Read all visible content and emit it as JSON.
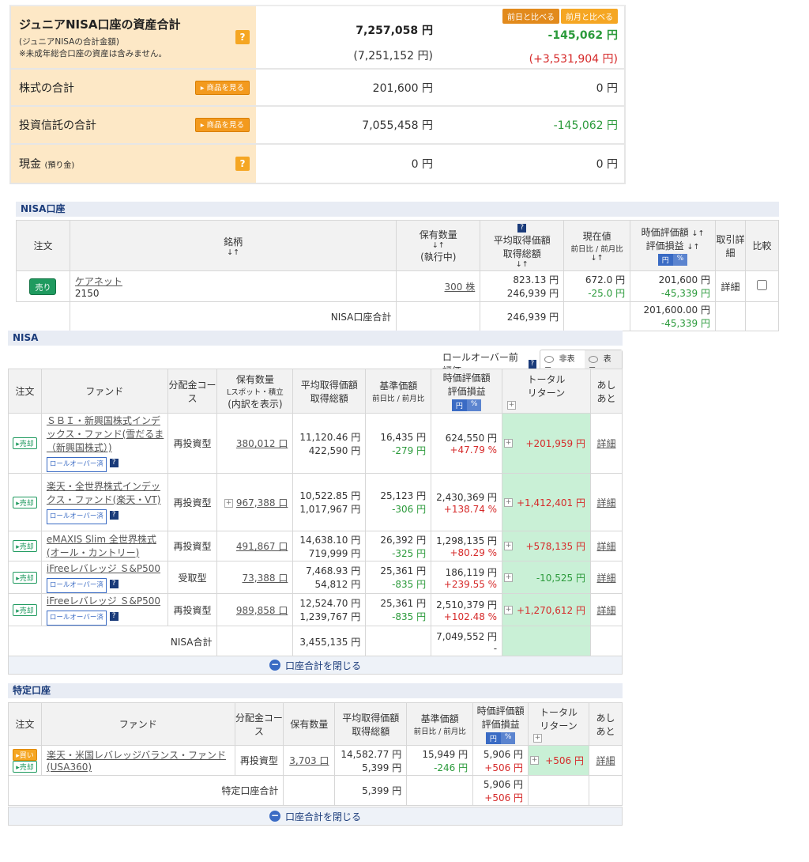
{
  "summary": {
    "compare_buttons": [
      "前日と比べる",
      "前月と比べる"
    ],
    "total": {
      "label": "ジュニアNISA口座の資産合計",
      "note1": "(ジュニアNISAの合計金額)",
      "note2": "※未成年総合口座の資産は含みません。",
      "value": "7,257,058 円",
      "value_sub": "(7,251,152 円)",
      "diff": "-145,062 円",
      "diff_sub": "(+3,531,904 円)"
    },
    "stocks": {
      "label": "株式の合計",
      "button": "商品を見る",
      "value": "201,600 円",
      "diff": "0 円"
    },
    "funds": {
      "label": "投資信託の合計",
      "button": "商品を見る",
      "value": "7,055,458 円",
      "diff": "-145,062 円"
    },
    "cash": {
      "label": "現金",
      "label_sub": "(預り金)",
      "value": "0 円",
      "diff": "0 円"
    }
  },
  "nisa_account": {
    "title": "NISA口座",
    "headers": {
      "order": "注文",
      "name": "銘柄",
      "qty": "保有数量",
      "qty_sub": "(執行中)",
      "avg": "平均取得価額",
      "avg_sub": "取得総額",
      "price": "現在値",
      "price_sub": "前日比 / 前月比",
      "val": "時価評価額",
      "val_sub": "評価損益",
      "trade": "取引詳細",
      "compare": "比較"
    },
    "row": {
      "button": "売り",
      "name": "ケアネット",
      "code": "2150",
      "qty": "300 株",
      "avg": "823.13 円",
      "total": "246,939 円",
      "price": "672.0 円",
      "change": "-25.0 円",
      "val": "201,600 円",
      "pl": "-45,339 円",
      "detail": "詳細"
    },
    "total": {
      "label": "NISA口座合計",
      "cost": "246,939 円",
      "val": "201,600.00 円",
      "pl": "-45,339 円"
    }
  },
  "nisa_funds": {
    "title": "NISA",
    "rollover_label": "ロールオーバー前評価",
    "toggle": [
      "非表示",
      "表示"
    ],
    "headers": {
      "order": "注文",
      "fund": "ファンド",
      "course": "分配金コース",
      "qty": "保有数量",
      "qty_sub": "Lスポット・積立",
      "qty_sub2": "(内訳を表示)",
      "avg": "平均取得価額",
      "avg_sub": "取得総額",
      "base": "基準価額",
      "base_sub": "前日比 / 前月比",
      "val": "時価評価額",
      "val_sub": "評価損益",
      "total_return": "トータルリターン",
      "ashi": "あしあと"
    },
    "rows": [
      {
        "name": "ＳＢＩ・新興国株式インデックス・ファンド(雪だるま（新興国株式）)",
        "course": "再投資型",
        "qty": "380,012 口",
        "avg": "11,120.46 円",
        "cost": "422,590 円",
        "base": "16,435 円",
        "change": "-279 円",
        "val": "624,550 円",
        "pl": "+47.79 %",
        "ret": "+201,959 円",
        "rollover": true
      },
      {
        "name": "楽天・全世界株式インデックス・ファンド(楽天・VT)",
        "course": "再投資型",
        "qty": "967,388 口",
        "avg": "10,522.85 円",
        "cost": "1,017,967 円",
        "base": "25,123 円",
        "change": "-306 円",
        "val": "2,430,369 円",
        "pl": "+138.74 %",
        "ret": "+1,412,401 円",
        "rollover": true
      },
      {
        "name": "eMAXIS Slim 全世界株式(オール・カントリー)",
        "course": "再投資型",
        "qty": "491,867 口",
        "avg": "14,638.10 円",
        "cost": "719,999 円",
        "base": "26,392 円",
        "change": "-325 円",
        "val": "1,298,135 円",
        "pl": "+80.29 %",
        "ret": "+578,135 円",
        "rollover": false
      },
      {
        "name": "iFreeレバレッジ Ｓ&P500",
        "course": "受取型",
        "qty": "73,388 口",
        "avg": "7,468.93 円",
        "cost": "54,812 円",
        "base": "25,361 円",
        "change": "-835 円",
        "val": "186,119 円",
        "pl": "+239.55 %",
        "ret": "-10,525 円",
        "rollover": true
      },
      {
        "name": "iFreeレバレッジ Ｓ&P500",
        "course": "再投資型",
        "qty": "989,858 口",
        "avg": "12,524.70 円",
        "cost": "1,239,767 円",
        "base": "25,361 円",
        "change": "-835 円",
        "val": "2,510,379 円",
        "pl": "+102.48 %",
        "ret": "+1,270,612 円",
        "rollover": true
      }
    ],
    "sell": "売却",
    "rollover_badge": "ロールオーバー済",
    "detail": "詳細",
    "total": {
      "label": "NISA合計",
      "cost": "3,455,135 円",
      "val": "7,049,552 円",
      "pl": "-"
    },
    "close": "口座合計を閉じる"
  },
  "tokutei": {
    "title": "特定口座",
    "headers": {
      "order": "注文",
      "fund": "ファンド",
      "course": "分配金コース",
      "qty": "保有数量",
      "avg": "平均取得価額",
      "avg_sub": "取得総額",
      "base": "基準価額",
      "base_sub": "前日比 / 前月比",
      "val": "時価評価額",
      "val_sub": "評価損益",
      "total_return": "トータルリターン",
      "ashi": "あしあと"
    },
    "row": {
      "buy": "買い",
      "sell": "売却",
      "name": "楽天・米国レバレッジバランス・ファンド(USA360)",
      "course": "再投資型",
      "qty": "3,703 口",
      "avg": "14,582.77 円",
      "cost": "5,399 円",
      "base": "15,949 円",
      "change": "-246 円",
      "val": "5,906 円",
      "pl": "+506 円",
      "ret": "+506 円",
      "detail": "詳細"
    },
    "total": {
      "label": "特定口座合計",
      "cost": "5,399 円",
      "val": "5,906 円",
      "pl": "+506 円"
    },
    "close": "口座合計を閉じる"
  },
  "ui": {
    "yen": "円",
    "pct": "%",
    "sort": "↓↑",
    "qmark": "?",
    "plus": "+"
  }
}
